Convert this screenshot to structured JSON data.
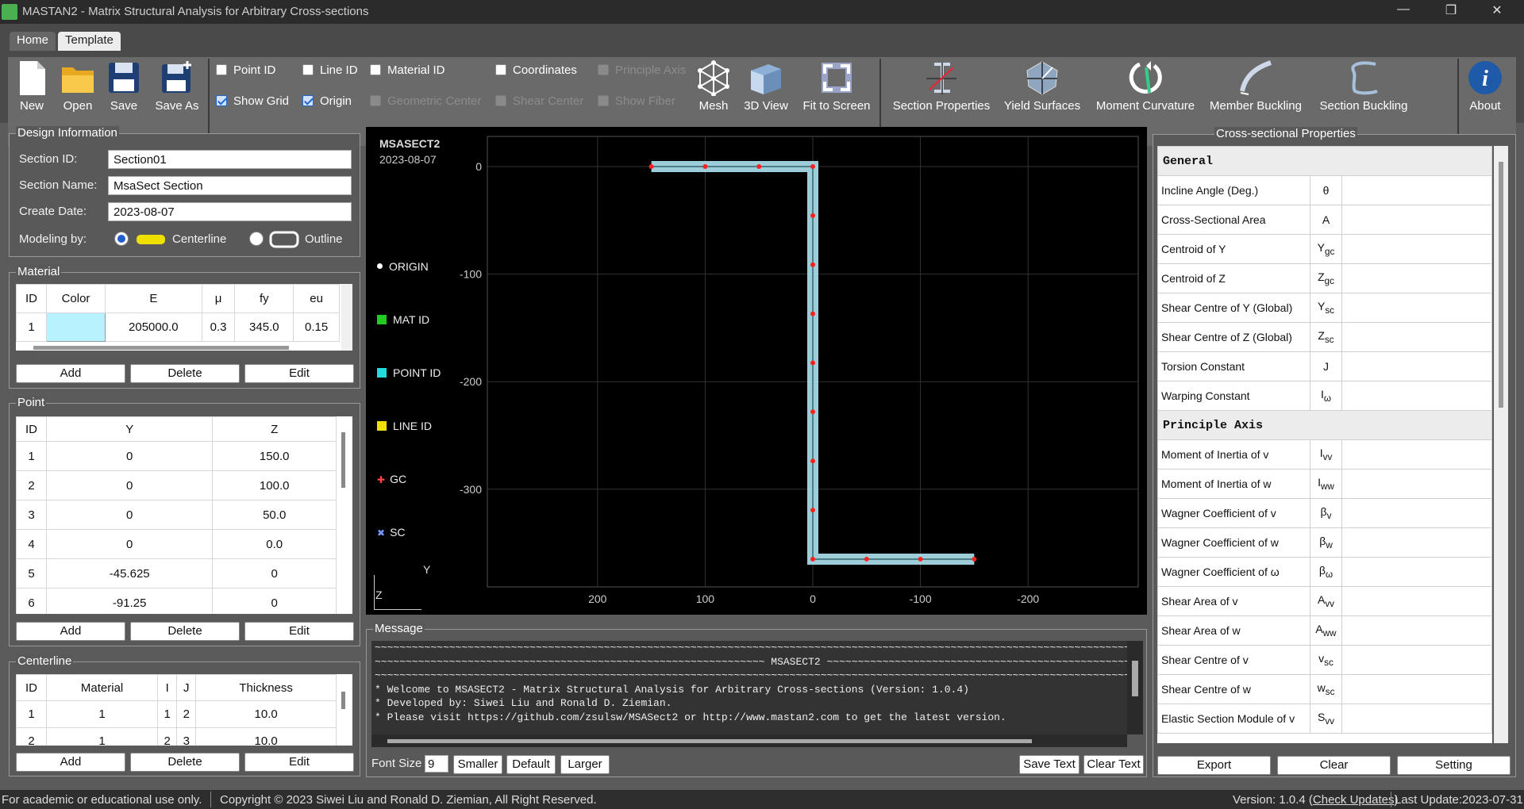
{
  "window": {
    "title": "MASTAN2 - Matrix Structural Analysis for Arbitrary Cross-sections",
    "minimize": "—",
    "restore": "❐",
    "close": "✕"
  },
  "tabs": [
    "Home",
    "Template"
  ],
  "toolbar": {
    "new": "New",
    "open": "Open",
    "save": "Save",
    "save_as": "Save As",
    "checks": {
      "point_id": "Point ID",
      "line_id": "Line ID",
      "material_id": "Material ID",
      "coordinates": "Coordinates",
      "principle_axis": "Principle Axis",
      "show_grid": "Show Grid",
      "origin": "Origin",
      "geometric_center": "Geometric Center",
      "shear_center": "Shear Center",
      "show_fiber": "Show Fiber"
    },
    "mesh": "Mesh",
    "view3d": "3D View",
    "fit": "Fit to Screen",
    "section_properties": "Section Properties",
    "yield_surfaces": "Yield Surfaces",
    "moment_curvature": "Moment Curvature",
    "member_buckling": "Member Buckling",
    "section_buckling": "Section Buckling",
    "about": "About"
  },
  "design": {
    "title": "Design Information",
    "section_id_label": "Section ID:",
    "section_id": "Section01",
    "section_name_label": "Section Name:",
    "section_name": "MsaSect Section",
    "create_date_label": "Create Date:",
    "create_date": "2023-08-07",
    "modeling_label": "Modeling by:",
    "centerline": "Centerline",
    "outline": "Outline"
  },
  "material": {
    "title": "Material",
    "headers": [
      "ID",
      "Color",
      "E",
      "μ",
      "fy",
      "eu"
    ],
    "row": {
      "id": "1",
      "color": "#b8f1ff",
      "E": "205000.0",
      "mu": "0.3",
      "fy": "345.0",
      "eu": "0.15"
    },
    "add": "Add",
    "delete": "Delete",
    "edit": "Edit"
  },
  "point": {
    "title": "Point",
    "headers": [
      "ID",
      "Y",
      "Z"
    ],
    "rows": [
      [
        "1",
        "0",
        "150.0"
      ],
      [
        "2",
        "0",
        "100.0"
      ],
      [
        "3",
        "0",
        "50.0"
      ],
      [
        "4",
        "0",
        "0.0"
      ],
      [
        "5",
        "-45.625",
        "0"
      ],
      [
        "6",
        "-91.25",
        "0"
      ]
    ],
    "add": "Add",
    "delete": "Delete",
    "edit": "Edit"
  },
  "centerline": {
    "title": "Centerline",
    "headers": [
      "ID",
      "Material",
      "I",
      "J",
      "Thickness"
    ],
    "rows": [
      [
        "1",
        "1",
        "1",
        "2",
        "10.0"
      ],
      [
        "2",
        "1",
        "2",
        "3",
        "10.0"
      ]
    ],
    "add": "Add",
    "delete": "Delete",
    "edit": "Edit"
  },
  "plot": {
    "program": "MSASECT2",
    "date": "2023-08-07",
    "legend": [
      "ORIGIN",
      "MAT ID",
      "POINT ID",
      "LINE ID",
      "GC",
      "SC"
    ],
    "legend_colors": [
      "#ffffff",
      "#22cc22",
      "#22dddd",
      "#f0e000",
      "#ff4444",
      "#7799ff"
    ],
    "yticks": [
      "0",
      "-100",
      "-200",
      "-300"
    ],
    "xticks": [
      "200",
      "100",
      "0",
      "-100",
      "-200"
    ],
    "axis_y": "Y",
    "axis_z": "Z"
  },
  "message": {
    "title": "Message",
    "lines": [
      "~~~~~~~~~~~~~~~~~~~~~~~~~~~~~~~~~~~~~~~~~~~~~~~~~~~~~~~~~~~~~~~~~~~~~~~~~~~~~~~~~~~~~~~~~~~~~~~~~~~~~~~~~~~~~~~~~~~~~~~~~~~~~~~~~~~~~~~~~~~~~~~~~~~~~~~~~~~~",
      "~~~~~~~~~~~~~~~~~~~~~~~~~~~~~~~~~~~~~~~~~~~~~~~~~~~~~~~~~~~~~~~ MSASECT2 ~~~~~~~~~~~~~~~~~~~~~~~~~~~~~~~~~~~~~~~~~~~~~~~~~~~~~~~~~~~~~~~~~~~~~~~~~~~~~~~~~~",
      "~~~~~~~~~~~~~~~~~~~~~~~~~~~~~~~~~~~~~~~~~~~~~~~~~~~~~~~~~~~~~~~~~~~~~~~~~~~~~~~~~~~~~~~~~~~~~~~~~~~~~~~~~~~~~~~~~~~~~~~~~~~~~~~~~~~~~~~~~~~~~~~~~~~~~~~~~~~~",
      "* Welcome to MSASECT2 - Matrix Structural Analysis for Arbitrary Cross-sections (Version: 1.0.4)",
      "* Developed by: Siwei Liu and Ronald D. Ziemian.",
      "* Please visit https://github.com/zsulsw/MSASect2 or http://www.mastan2.com to get the latest version."
    ],
    "font_size_label": "Font Size",
    "font_size": "9",
    "smaller": "Smaller",
    "default": "Default",
    "larger": "Larger",
    "save_text": "Save Text",
    "clear_text": "Clear Text"
  },
  "props": {
    "title": "Cross-sectional Properties",
    "general": "General",
    "general_rows": [
      [
        "Incline Angle (Deg.)",
        "θ"
      ],
      [
        "Cross-Sectional Area",
        "A"
      ],
      [
        "Centroid of Y",
        "Y<sub>gc</sub>"
      ],
      [
        "Centroid of Z",
        "Z<sub>gc</sub>"
      ],
      [
        "Shear Centre of Y (Global)",
        "Y<sub>sc</sub>"
      ],
      [
        "Shear Centre of Z (Global)",
        "Z<sub>sc</sub>"
      ],
      [
        "Torsion Constant",
        "J"
      ],
      [
        "Warping Constant",
        "I<sub>ω</sub>"
      ]
    ],
    "principle": "Principle Axis",
    "principle_rows": [
      [
        "Moment of Inertia of v",
        "I<sub>vv</sub>"
      ],
      [
        "Moment of Inertia of w",
        "I<sub>ww</sub>"
      ],
      [
        "Wagner Coefficient of v",
        "β<sub>v</sub>"
      ],
      [
        "Wagner Coefficient of w",
        "β<sub>w</sub>"
      ],
      [
        "Wagner Coefficient of ω",
        "β<sub>ω</sub>"
      ],
      [
        "Shear Area of v",
        "A<sub>vv</sub>"
      ],
      [
        "Shear Area of w",
        "A<sub>ww</sub>"
      ],
      [
        "Shear Centre of v",
        "v<sub>sc</sub>"
      ],
      [
        "Shear Centre of w",
        "w<sub>sc</sub>"
      ],
      [
        "Elastic Section Module of v",
        "S<sub>vv</sub>"
      ]
    ],
    "export": "Export",
    "clear": "Clear",
    "setting": "Setting"
  },
  "status": {
    "left": "For academic or educational use only.",
    "copyright": "Copyright © 2023 Siwei Liu and Ronald D. Ziemian, All Right Reserved.",
    "version": "Version: 1.0.4 (",
    "check_updates": "Check Updates",
    "version_end": ")",
    "last_update": "Last Update:2023-07-31"
  }
}
